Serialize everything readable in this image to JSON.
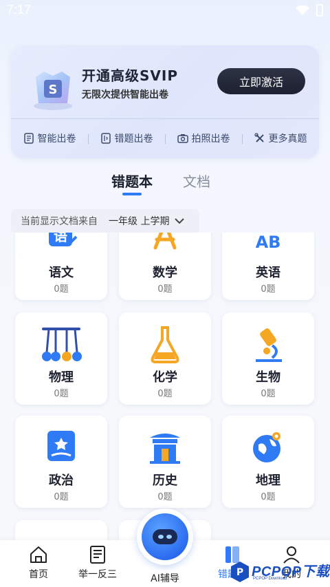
{
  "status_bar": {
    "time": "7:17"
  },
  "promo": {
    "title": "开通高级SVIP",
    "subtitle": "无限次提供智能出卷",
    "button": "立即激活",
    "quick_actions": [
      {
        "label": "智能出卷",
        "icon": "document-icon"
      },
      {
        "label": "错题出卷",
        "icon": "error-book-icon"
      },
      {
        "label": "拍照出卷",
        "icon": "camera-icon"
      },
      {
        "label": "更多真题",
        "icon": "tools-icon"
      }
    ]
  },
  "tabs": [
    {
      "label": "错题本",
      "active": true
    },
    {
      "label": "文档",
      "active": false
    }
  ],
  "filter": {
    "prefix": "当前显示文档来自",
    "grade": "一年级 上学期"
  },
  "subjects": [
    {
      "name": "语文",
      "count": "0题",
      "icon": "chinese-icon"
    },
    {
      "name": "数学",
      "count": "0题",
      "icon": "compass-icon"
    },
    {
      "name": "英语",
      "count": "0题",
      "icon": "english-ab-icon"
    },
    {
      "name": "物理",
      "count": "0题",
      "icon": "newton-cradle-icon"
    },
    {
      "name": "化学",
      "count": "0题",
      "icon": "flask-icon"
    },
    {
      "name": "生物",
      "count": "0题",
      "icon": "microscope-icon"
    },
    {
      "name": "政治",
      "count": "0题",
      "icon": "politics-book-icon"
    },
    {
      "name": "历史",
      "count": "0题",
      "icon": "temple-icon"
    },
    {
      "name": "地理",
      "count": "0题",
      "icon": "globe-icon"
    }
  ],
  "nav": [
    {
      "label": "首页",
      "icon": "home-icon"
    },
    {
      "label": "举一反三",
      "icon": "list-book-icon"
    },
    {
      "label": "AI辅导",
      "icon": "robot-icon"
    },
    {
      "label": "错题本",
      "icon": "error-book-nav-icon",
      "active": true
    },
    {
      "label": "我的",
      "icon": "user-icon"
    }
  ],
  "watermark": {
    "text": "PCPOP下载",
    "small": "PCPOP Download"
  },
  "colors": {
    "accent": "#2f7bf5",
    "orange": "#f5a623",
    "dark_button": "#1c2030"
  }
}
